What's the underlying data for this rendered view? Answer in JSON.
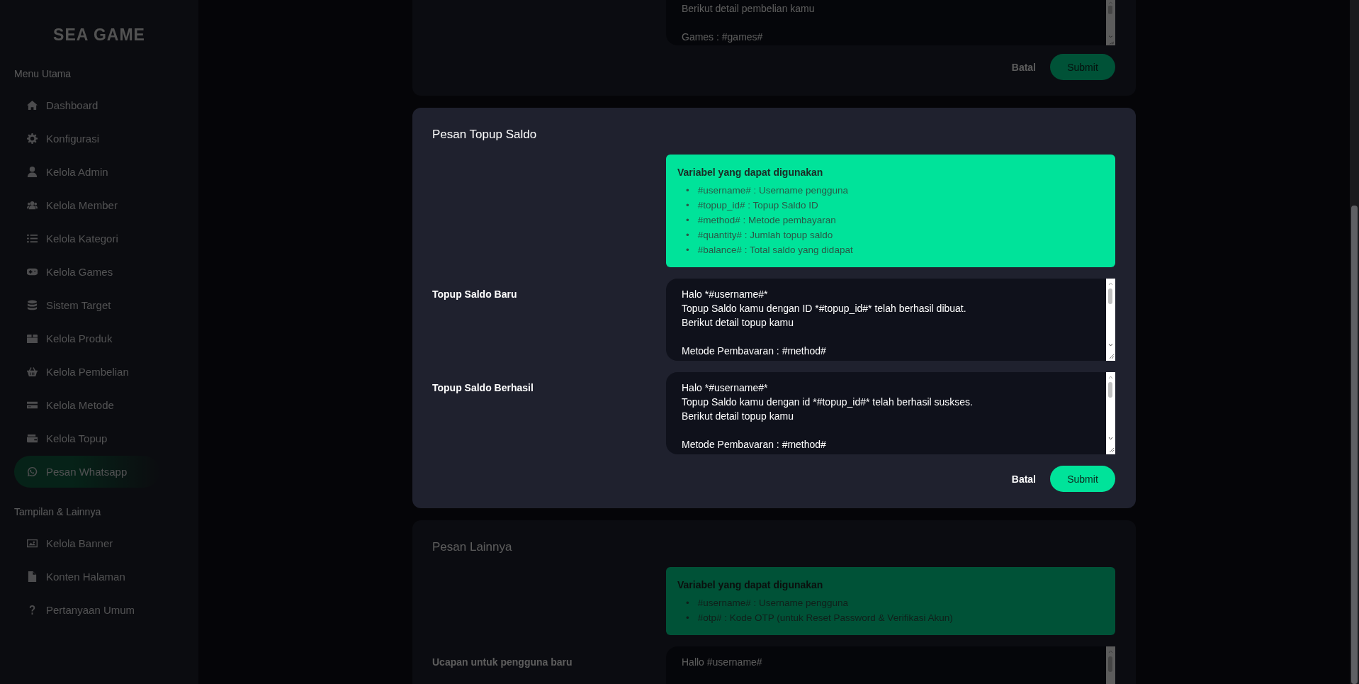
{
  "sidebar": {
    "logo": "SEA GAME",
    "dimmed": true,
    "sections": [
      {
        "title": "Menu Utama",
        "items": [
          {
            "label": "Dashboard",
            "selected": false
          },
          {
            "label": "Konfigurasi",
            "selected": false
          },
          {
            "label": "Kelola Admin",
            "selected": false
          },
          {
            "label": "Kelola Member",
            "selected": false
          },
          {
            "label": "Kelola Kategori",
            "selected": false
          },
          {
            "label": "Kelola Games",
            "selected": false
          },
          {
            "label": "Sistem Target",
            "selected": false
          },
          {
            "label": "Kelola Produk",
            "selected": false
          },
          {
            "label": "Kelola Pembelian",
            "selected": false
          },
          {
            "label": "Kelola Metode",
            "selected": false
          },
          {
            "label": "Kelola Topup",
            "selected": false
          },
          {
            "label": "Pesan Whatsapp",
            "selected": true
          }
        ]
      },
      {
        "title": "Tampilan & Lainnya",
        "items": [
          {
            "label": "Kelola Banner",
            "selected": false
          },
          {
            "label": "Konten Halaman",
            "selected": false
          },
          {
            "label": "Pertanyaan Umum",
            "selected": false
          }
        ]
      }
    ]
  },
  "cards": [
    {
      "focused": false,
      "fields": [
        {
          "value": "Berikut detail pembelian kamu\n\nGames : #games#"
        }
      ],
      "cancel": "Batal",
      "submit": "Submit"
    },
    {
      "focused": true,
      "title": "Pesan Topup Saldo",
      "info": {
        "title": "Variabel yang dapat digunakan",
        "bullet": "•",
        "items": [
          "#username# : Username pengguna",
          "#topup_id# : Topup Saldo ID",
          "#method# : Metode pembayaran",
          "#quantity# : Jumlah topup saldo",
          "#balance# : Total saldo yang didapat"
        ]
      },
      "fields": [
        {
          "label": "Topup Saldo Baru",
          "value": "Halo *#username#*\nTopup Saldo kamu dengan ID *#topup_id#* telah berhasil dibuat.\nBerikut detail topup kamu\n\nMetode Pembavaran : #method#"
        },
        {
          "label": "Topup Saldo Berhasil",
          "value": "Halo *#username#*\nTopup Saldo kamu dengan id *#topup_id#* telah berhasil suskses.\nBerikut detail topup kamu\n\nMetode Pembavaran : #method#"
        }
      ],
      "cancel": "Batal",
      "submit": "Submit"
    },
    {
      "focused": false,
      "title": "Pesan Lainnya",
      "info": {
        "title": "Variabel yang dapat digunakan",
        "bullet": "•",
        "items": [
          "#username# : Username pengguna",
          "#otp# : Kode OTP (untuk Reset Password & Verifikasi Akun)"
        ]
      },
      "fields": [
        {
          "label": "Ucapan untuk pengguna baru",
          "value": "Hallo #username#"
        }
      ]
    }
  ]
}
